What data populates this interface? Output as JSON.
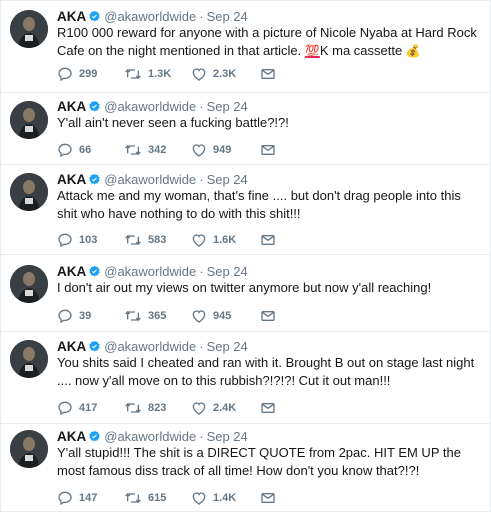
{
  "tweets": [
    {
      "name": "AKA",
      "handle": "@akaworldwide",
      "separator": "·",
      "date": "Sep 24",
      "text": "R100 000 reward for anyone with a picture of Nicole Nyaba at Hard Rock Cafe on the night mentioned in that article.",
      "text_suffix_emoji": "💯",
      "text_suffix": "K ma cassette",
      "text_end_emoji": "💰",
      "replies": "299",
      "retweets": "1.3K",
      "likes": "2.3K"
    },
    {
      "name": "AKA",
      "handle": "@akaworldwide",
      "separator": "·",
      "date": "Sep 24",
      "text": "Y'all ain't never seen a fucking battle?!?!",
      "replies": "66",
      "retweets": "342",
      "likes": "949"
    },
    {
      "name": "AKA",
      "handle": "@akaworldwide",
      "separator": "·",
      "date": "Sep 24",
      "text": "Attack me and my woman, that's fine .... but don't drag people into this shit who have nothing to do with this shit!!!",
      "replies": "103",
      "retweets": "583",
      "likes": "1.6K"
    },
    {
      "name": "AKA",
      "handle": "@akaworldwide",
      "separator": "·",
      "date": "Sep 24",
      "text": "I don't air out my views on twitter anymore but now y'all reaching!",
      "replies": "39",
      "retweets": "365",
      "likes": "945"
    },
    {
      "name": "AKA",
      "handle": "@akaworldwide",
      "separator": "·",
      "date": "Sep 24",
      "text": "You shits said I cheated and ran with it. Brought B out on stage last night .... now y'all move on to this rubbish?!?!?! Cut it out man!!!",
      "replies": "417",
      "retweets": "823",
      "likes": "2.4K"
    },
    {
      "name": "AKA",
      "handle": "@akaworldwide",
      "separator": "·",
      "date": "Sep 24",
      "text": "Y'all stupid!!! The shit is a DIRECT QUOTE from 2pac. HIT EM UP the most famous diss track of all time! How don't you know that?!?!",
      "replies": "147",
      "retweets": "615",
      "likes": "1.4K"
    }
  ],
  "colors": {
    "verified": "#1da1f2",
    "icon": "#657786",
    "border": "#e6ecf0"
  },
  "icons": [
    "reply-icon",
    "retweet-icon",
    "like-icon",
    "direct-message-icon",
    "verified-badge-icon"
  ]
}
